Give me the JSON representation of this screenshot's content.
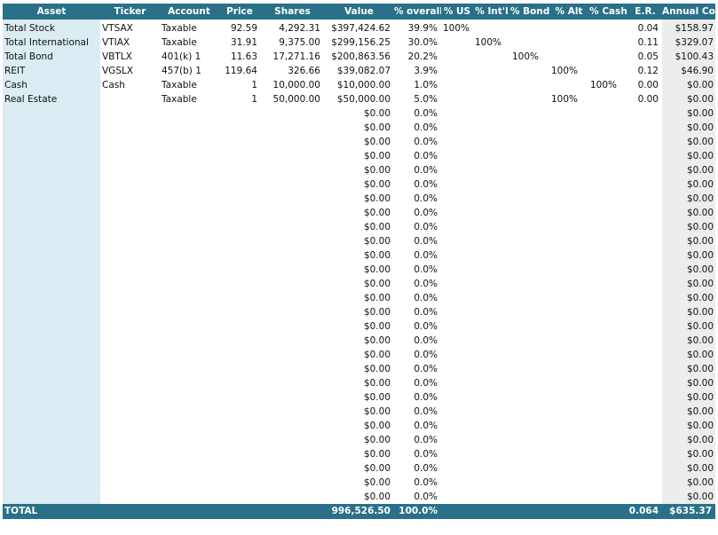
{
  "headers": {
    "asset": "Asset",
    "ticker": "Ticker",
    "account": "Account",
    "price": "Price",
    "shares": "Shares",
    "value": "Value",
    "overall": "% overall",
    "us": "% US",
    "intl": "% Int'l",
    "bond": "% Bond",
    "alt": "% Alt",
    "cash": "% Cash",
    "er": "E.R.",
    "cost": "Annual Cost"
  },
  "rows": [
    {
      "asset": "Total Stock",
      "ticker": "VTSAX",
      "account": "Taxable",
      "price": "92.59",
      "shares": "4,292.31",
      "value": "$397,424.62",
      "overall": "39.9%",
      "us": "100%",
      "intl": "",
      "bond": "",
      "alt": "",
      "cash": "",
      "er": "0.04",
      "cost": "$158.97"
    },
    {
      "asset": "Total International",
      "ticker": "VTIAX",
      "account": "Taxable",
      "price": "31.91",
      "shares": "9,375.00",
      "value": "$299,156.25",
      "overall": "30.0%",
      "us": "",
      "intl": "100%",
      "bond": "",
      "alt": "",
      "cash": "",
      "er": "0.11",
      "cost": "$329.07"
    },
    {
      "asset": "Total Bond",
      "ticker": "VBTLX",
      "account": "401(k) 1",
      "price": "11.63",
      "shares": "17,271.16",
      "value": "$200,863.56",
      "overall": "20.2%",
      "us": "",
      "intl": "",
      "bond": "100%",
      "alt": "",
      "cash": "",
      "er": "0.05",
      "cost": "$100.43"
    },
    {
      "asset": "REIT",
      "ticker": "VGSLX",
      "account": "457(b) 1",
      "price": "119.64",
      "shares": "326.66",
      "value": "$39,082.07",
      "overall": "3.9%",
      "us": "",
      "intl": "",
      "bond": "",
      "alt": "100%",
      "cash": "",
      "er": "0.12",
      "cost": "$46.90"
    },
    {
      "asset": "Cash",
      "ticker": "Cash",
      "account": "Taxable",
      "price": "1",
      "shares": "10,000.00",
      "value": "$10,000.00",
      "overall": "1.0%",
      "us": "",
      "intl": "",
      "bond": "",
      "alt": "",
      "cash": "100%",
      "er": "0.00",
      "cost": "$0.00"
    },
    {
      "asset": "Real Estate",
      "ticker": "",
      "account": "Taxable",
      "price": "1",
      "shares": "50,000.00",
      "value": "$50,000.00",
      "overall": "5.0%",
      "us": "",
      "intl": "",
      "bond": "",
      "alt": "100%",
      "cash": "",
      "er": "0.00",
      "cost": "$0.00"
    },
    {
      "asset": "",
      "ticker": "",
      "account": "",
      "price": "",
      "shares": "",
      "value": "$0.00",
      "overall": "0.0%",
      "us": "",
      "intl": "",
      "bond": "",
      "alt": "",
      "cash": "",
      "er": "",
      "cost": "$0.00"
    },
    {
      "asset": "",
      "ticker": "",
      "account": "",
      "price": "",
      "shares": "",
      "value": "$0.00",
      "overall": "0.0%",
      "us": "",
      "intl": "",
      "bond": "",
      "alt": "",
      "cash": "",
      "er": "",
      "cost": "$0.00"
    },
    {
      "asset": "",
      "ticker": "",
      "account": "",
      "price": "",
      "shares": "",
      "value": "$0.00",
      "overall": "0.0%",
      "us": "",
      "intl": "",
      "bond": "",
      "alt": "",
      "cash": "",
      "er": "",
      "cost": "$0.00"
    },
    {
      "asset": "",
      "ticker": "",
      "account": "",
      "price": "",
      "shares": "",
      "value": "$0.00",
      "overall": "0.0%",
      "us": "",
      "intl": "",
      "bond": "",
      "alt": "",
      "cash": "",
      "er": "",
      "cost": "$0.00"
    },
    {
      "asset": "",
      "ticker": "",
      "account": "",
      "price": "",
      "shares": "",
      "value": "$0.00",
      "overall": "0.0%",
      "us": "",
      "intl": "",
      "bond": "",
      "alt": "",
      "cash": "",
      "er": "",
      "cost": "$0.00"
    },
    {
      "asset": "",
      "ticker": "",
      "account": "",
      "price": "",
      "shares": "",
      "value": "$0.00",
      "overall": "0.0%",
      "us": "",
      "intl": "",
      "bond": "",
      "alt": "",
      "cash": "",
      "er": "",
      "cost": "$0.00"
    },
    {
      "asset": "",
      "ticker": "",
      "account": "",
      "price": "",
      "shares": "",
      "value": "$0.00",
      "overall": "0.0%",
      "us": "",
      "intl": "",
      "bond": "",
      "alt": "",
      "cash": "",
      "er": "",
      "cost": "$0.00"
    },
    {
      "asset": "",
      "ticker": "",
      "account": "",
      "price": "",
      "shares": "",
      "value": "$0.00",
      "overall": "0.0%",
      "us": "",
      "intl": "",
      "bond": "",
      "alt": "",
      "cash": "",
      "er": "",
      "cost": "$0.00"
    },
    {
      "asset": "",
      "ticker": "",
      "account": "",
      "price": "",
      "shares": "",
      "value": "$0.00",
      "overall": "0.0%",
      "us": "",
      "intl": "",
      "bond": "",
      "alt": "",
      "cash": "",
      "er": "",
      "cost": "$0.00"
    },
    {
      "asset": "",
      "ticker": "",
      "account": "",
      "price": "",
      "shares": "",
      "value": "$0.00",
      "overall": "0.0%",
      "us": "",
      "intl": "",
      "bond": "",
      "alt": "",
      "cash": "",
      "er": "",
      "cost": "$0.00"
    },
    {
      "asset": "",
      "ticker": "",
      "account": "",
      "price": "",
      "shares": "",
      "value": "$0.00",
      "overall": "0.0%",
      "us": "",
      "intl": "",
      "bond": "",
      "alt": "",
      "cash": "",
      "er": "",
      "cost": "$0.00"
    },
    {
      "asset": "",
      "ticker": "",
      "account": "",
      "price": "",
      "shares": "",
      "value": "$0.00",
      "overall": "0.0%",
      "us": "",
      "intl": "",
      "bond": "",
      "alt": "",
      "cash": "",
      "er": "",
      "cost": "$0.00"
    },
    {
      "asset": "",
      "ticker": "",
      "account": "",
      "price": "",
      "shares": "",
      "value": "$0.00",
      "overall": "0.0%",
      "us": "",
      "intl": "",
      "bond": "",
      "alt": "",
      "cash": "",
      "er": "",
      "cost": "$0.00"
    },
    {
      "asset": "",
      "ticker": "",
      "account": "",
      "price": "",
      "shares": "",
      "value": "$0.00",
      "overall": "0.0%",
      "us": "",
      "intl": "",
      "bond": "",
      "alt": "",
      "cash": "",
      "er": "",
      "cost": "$0.00"
    },
    {
      "asset": "",
      "ticker": "",
      "account": "",
      "price": "",
      "shares": "",
      "value": "$0.00",
      "overall": "0.0%",
      "us": "",
      "intl": "",
      "bond": "",
      "alt": "",
      "cash": "",
      "er": "",
      "cost": "$0.00"
    },
    {
      "asset": "",
      "ticker": "",
      "account": "",
      "price": "",
      "shares": "",
      "value": "$0.00",
      "overall": "0.0%",
      "us": "",
      "intl": "",
      "bond": "",
      "alt": "",
      "cash": "",
      "er": "",
      "cost": "$0.00"
    },
    {
      "asset": "",
      "ticker": "",
      "account": "",
      "price": "",
      "shares": "",
      "value": "$0.00",
      "overall": "0.0%",
      "us": "",
      "intl": "",
      "bond": "",
      "alt": "",
      "cash": "",
      "er": "",
      "cost": "$0.00"
    },
    {
      "asset": "",
      "ticker": "",
      "account": "",
      "price": "",
      "shares": "",
      "value": "$0.00",
      "overall": "0.0%",
      "us": "",
      "intl": "",
      "bond": "",
      "alt": "",
      "cash": "",
      "er": "",
      "cost": "$0.00"
    },
    {
      "asset": "",
      "ticker": "",
      "account": "",
      "price": "",
      "shares": "",
      "value": "$0.00",
      "overall": "0.0%",
      "us": "",
      "intl": "",
      "bond": "",
      "alt": "",
      "cash": "",
      "er": "",
      "cost": "$0.00"
    },
    {
      "asset": "",
      "ticker": "",
      "account": "",
      "price": "",
      "shares": "",
      "value": "$0.00",
      "overall": "0.0%",
      "us": "",
      "intl": "",
      "bond": "",
      "alt": "",
      "cash": "",
      "er": "",
      "cost": "$0.00"
    },
    {
      "asset": "",
      "ticker": "",
      "account": "",
      "price": "",
      "shares": "",
      "value": "$0.00",
      "overall": "0.0%",
      "us": "",
      "intl": "",
      "bond": "",
      "alt": "",
      "cash": "",
      "er": "",
      "cost": "$0.00"
    },
    {
      "asset": "",
      "ticker": "",
      "account": "",
      "price": "",
      "shares": "",
      "value": "$0.00",
      "overall": "0.0%",
      "us": "",
      "intl": "",
      "bond": "",
      "alt": "",
      "cash": "",
      "er": "",
      "cost": "$0.00"
    },
    {
      "asset": "",
      "ticker": "",
      "account": "",
      "price": "",
      "shares": "",
      "value": "$0.00",
      "overall": "0.0%",
      "us": "",
      "intl": "",
      "bond": "",
      "alt": "",
      "cash": "",
      "er": "",
      "cost": "$0.00"
    },
    {
      "asset": "",
      "ticker": "",
      "account": "",
      "price": "",
      "shares": "",
      "value": "$0.00",
      "overall": "0.0%",
      "us": "",
      "intl": "",
      "bond": "",
      "alt": "",
      "cash": "",
      "er": "",
      "cost": "$0.00"
    },
    {
      "asset": "",
      "ticker": "",
      "account": "",
      "price": "",
      "shares": "",
      "value": "$0.00",
      "overall": "0.0%",
      "us": "",
      "intl": "",
      "bond": "",
      "alt": "",
      "cash": "",
      "er": "",
      "cost": "$0.00"
    },
    {
      "asset": "",
      "ticker": "",
      "account": "",
      "price": "",
      "shares": "",
      "value": "$0.00",
      "overall": "0.0%",
      "us": "",
      "intl": "",
      "bond": "",
      "alt": "",
      "cash": "",
      "er": "",
      "cost": "$0.00"
    },
    {
      "asset": "",
      "ticker": "",
      "account": "",
      "price": "",
      "shares": "",
      "value": "$0.00",
      "overall": "0.0%",
      "us": "",
      "intl": "",
      "bond": "",
      "alt": "",
      "cash": "",
      "er": "",
      "cost": "$0.00"
    },
    {
      "asset": "",
      "ticker": "",
      "account": "",
      "price": "",
      "shares": "",
      "value": "$0.00",
      "overall": "0.0%",
      "us": "",
      "intl": "",
      "bond": "",
      "alt": "",
      "cash": "",
      "er": "",
      "cost": "$0.00"
    }
  ],
  "total": {
    "label": "TOTAL",
    "value": "996,526.50",
    "overall": "100.0%",
    "er": "0.064",
    "cost": "$635.37"
  },
  "colors": {
    "header_bg": "#2a7088",
    "asset_column_bg": "#dbecf3",
    "cost_column_bg": "#eceeee"
  }
}
